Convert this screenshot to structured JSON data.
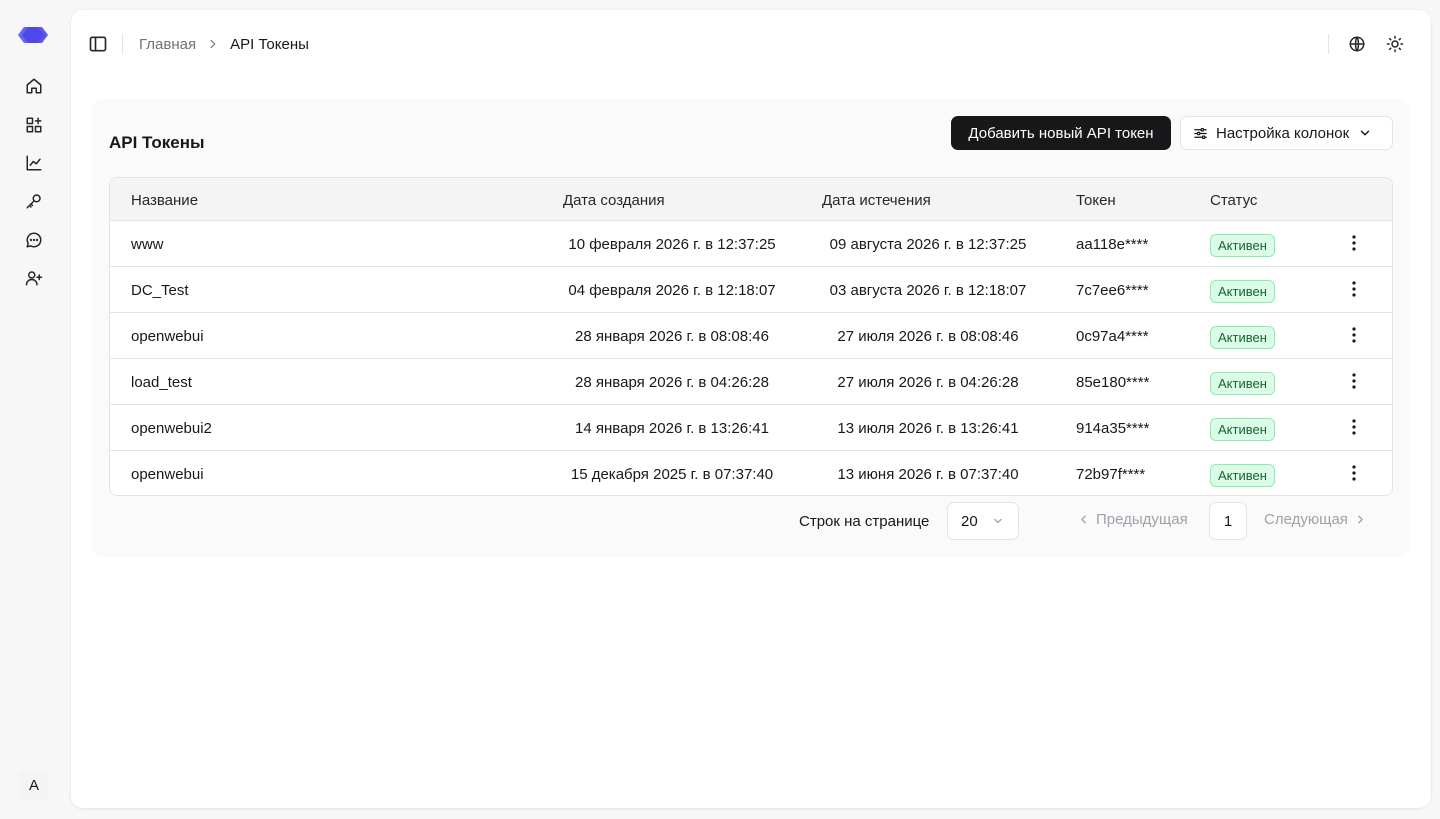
{
  "breadcrumb": {
    "home": "Главная",
    "current": "API Токены"
  },
  "sidebar": {
    "items": [
      {
        "icon": "home-icon"
      },
      {
        "icon": "grid-plus-icon"
      },
      {
        "icon": "chart-line-icon"
      },
      {
        "icon": "key-icon"
      },
      {
        "icon": "chat-icon"
      },
      {
        "icon": "user-plus-icon"
      }
    ],
    "avatar": "A"
  },
  "card": {
    "title": "API Токены",
    "add_button": "Добавить новый API токен",
    "columns_button": "Настройка колонок"
  },
  "table": {
    "headers": {
      "name": "Название",
      "created": "Дата создания",
      "expires": "Дата истечения",
      "token": "Токен",
      "status": "Статус"
    },
    "rows": [
      {
        "name": "www",
        "created": "10 февраля 2026 г. в 12:37:25",
        "expires": "09 августа 2026 г. в 12:37:25",
        "token": "aa118e****",
        "status": "Активен"
      },
      {
        "name": "DC_Test",
        "created": "04 февраля 2026 г. в 12:18:07",
        "expires": "03 августа 2026 г. в 12:18:07",
        "token": "7c7ee6****",
        "status": "Активен"
      },
      {
        "name": "openwebui",
        "created": "28 января 2026 г. в 08:08:46",
        "expires": "27 июля 2026 г. в 08:08:46",
        "token": "0c97a4****",
        "status": "Активен"
      },
      {
        "name": "load_test",
        "created": "28 января 2026 г. в 04:26:28",
        "expires": "27 июля 2026 г. в 04:26:28",
        "token": "85e180****",
        "status": "Активен"
      },
      {
        "name": "openwebui2",
        "created": "14 января 2026 г. в 13:26:41",
        "expires": "13 июля 2026 г. в 13:26:41",
        "token": "914a35****",
        "status": "Активен"
      },
      {
        "name": "openwebui",
        "created": "15 декабря 2025 г. в 07:37:40",
        "expires": "13 июня 2026 г. в 07:37:40",
        "token": "72b97f****",
        "status": "Активен"
      }
    ]
  },
  "pagination": {
    "rows_label": "Строк на странице",
    "rows_value": "20",
    "prev": "Предыдущая",
    "next": "Следующая",
    "current_page": "1"
  },
  "colors": {
    "primary": "#18181b",
    "badge_bg": "#dcfce7",
    "badge_text": "#166534",
    "logo": "#4f46e5"
  }
}
